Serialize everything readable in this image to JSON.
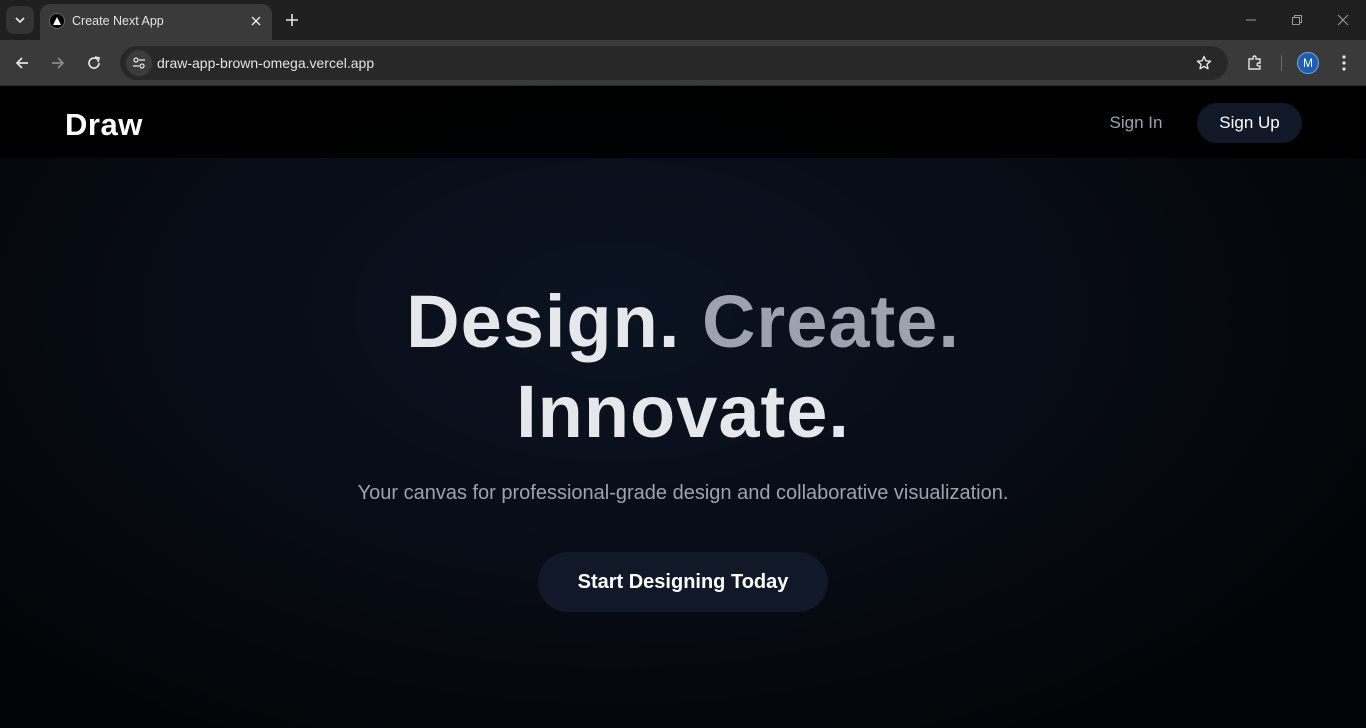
{
  "browser": {
    "tab_title": "Create Next App",
    "url": "draw-app-brown-omega.vercel.app",
    "profile_initial": "M"
  },
  "site": {
    "logo": "Draw",
    "nav": {
      "sign_in": "Sign In",
      "sign_up": "Sign Up"
    }
  },
  "hero": {
    "word1": "Design.",
    "word2": "Create.",
    "word3": "Innovate.",
    "tagline": "Your canvas for professional-grade design and collaborative visualization.",
    "cta": "Start Designing Today"
  },
  "colors": {
    "header_bg": "#000000",
    "button_bg": "#111827",
    "heading_light": "#e5e7eb",
    "heading_muted": "#9ca3af"
  }
}
